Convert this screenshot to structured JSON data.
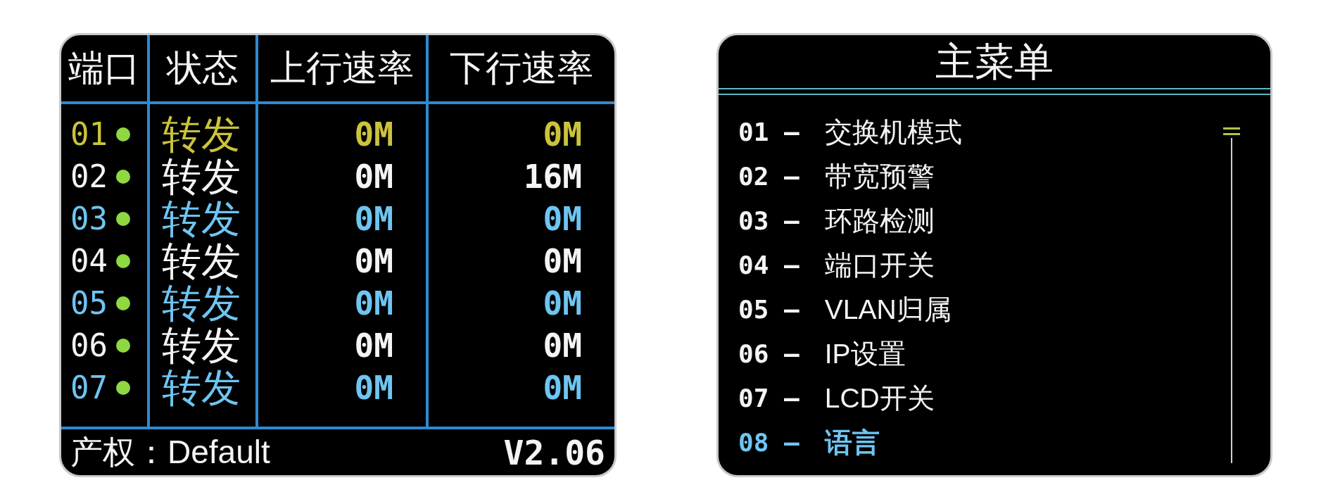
{
  "port_table": {
    "columns": [
      "端口",
      "状态",
      "上行速率",
      "下行速率"
    ],
    "rows": [
      {
        "port": "01",
        "link_up": true,
        "status": "转发",
        "upload": "0M",
        "download": "0M",
        "selected": true
      },
      {
        "port": "02",
        "link_up": true,
        "status": "转发",
        "upload": "0M",
        "download": "16M",
        "selected": false
      },
      {
        "port": "03",
        "link_up": true,
        "status": "转发",
        "upload": "0M",
        "download": "0M",
        "selected": false
      },
      {
        "port": "04",
        "link_up": true,
        "status": "转发",
        "upload": "0M",
        "download": "0M",
        "selected": false
      },
      {
        "port": "05",
        "link_up": true,
        "status": "转发",
        "upload": "0M",
        "download": "0M",
        "selected": false
      },
      {
        "port": "06",
        "link_up": true,
        "status": "转发",
        "upload": "0M",
        "download": "0M",
        "selected": false
      },
      {
        "port": "07",
        "link_up": true,
        "status": "转发",
        "upload": "0M",
        "download": "0M",
        "selected": false
      }
    ]
  },
  "footer": {
    "copyright": "产权：Default",
    "version": "V2.06"
  },
  "main_menu": {
    "title": "主菜单",
    "items": [
      {
        "index": "01 –",
        "label": "交换机模式",
        "selected": false
      },
      {
        "index": "02 –",
        "label": "带宽预警",
        "selected": false
      },
      {
        "index": "03 –",
        "label": "环路检测",
        "selected": false
      },
      {
        "index": "04 –",
        "label": "端口开关",
        "selected": false
      },
      {
        "index": "05 –",
        "label": "VLAN归属",
        "selected": false
      },
      {
        "index": "06 –",
        "label": "IP设置",
        "selected": false
      },
      {
        "index": "07 –",
        "label": "LCD开关",
        "selected": false
      },
      {
        "index": "08 –",
        "label": "语言",
        "selected": true
      }
    ]
  }
}
